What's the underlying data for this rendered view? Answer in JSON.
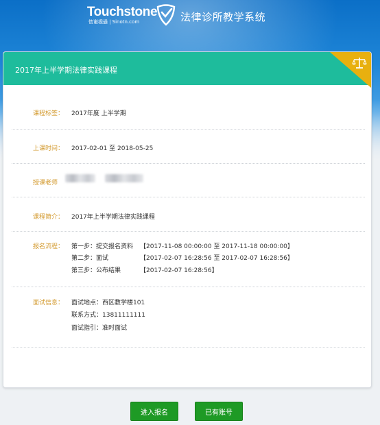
{
  "header": {
    "logo_main": "Touchstone",
    "logo_sub": "信诺视通 | Sinotn.com",
    "system_title": "法律诊所教学系统"
  },
  "course": {
    "title": "2017年上半学期法律实践课程"
  },
  "fields": {
    "tag_label": "课程标签：",
    "tag_value": "2017年度 上半学期",
    "time_label": "上课时间：",
    "time_value": "2017-02-01 至 2018-05-25",
    "teacher_label": "授课老师",
    "intro_label": "课程简介：",
    "intro_value": "2017年上半学期法律实践课程",
    "process_label": "报名流程：",
    "steps": [
      {
        "name": "第一步：提交报名资料",
        "time": "【2017-11-08 00:00:00 至 2017-11-18 00:00:00】"
      },
      {
        "name": "第二步：面试",
        "time": "【2017-02-07 16:28:56 至 2017-02-07 16:28:56】"
      },
      {
        "name": "第三步：公布结果",
        "time": "【2017-02-07 16:28:56】"
      }
    ],
    "interview_label": "面试信息：",
    "interview_lines": [
      "面试地点：西区教学楼101",
      "联系方式：13811111111",
      "面试指引：准时面试"
    ]
  },
  "buttons": {
    "enroll": "进入报名",
    "have_account": "已有账号"
  },
  "colors": {
    "header_bg": "#1ebc9c",
    "ribbon": "#e8b00f",
    "label": "#d39a2f",
    "button": "#1e9a25"
  }
}
